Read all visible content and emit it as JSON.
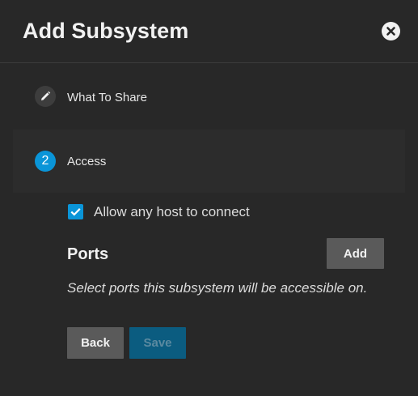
{
  "dialog": {
    "title": "Add Subsystem",
    "close_icon": "close-circle-icon"
  },
  "stepper": {
    "steps": [
      {
        "label": "What To Share",
        "icon": "pencil-icon",
        "state": "completed"
      },
      {
        "number": "2",
        "label": "Access",
        "state": "active"
      }
    ]
  },
  "access": {
    "allow_any_host": {
      "label": "Allow any host to connect",
      "checked": true
    },
    "ports": {
      "heading": "Ports",
      "add_label": "Add",
      "hint": "Select ports this subsystem will be accessible on."
    }
  },
  "actions": {
    "back_label": "Back",
    "save_label": "Save",
    "save_disabled": true
  },
  "colors": {
    "background": "#282828",
    "accent": "#0a95d8",
    "button": "#5a5a5a",
    "disabled_primary": "#0b5c80"
  }
}
